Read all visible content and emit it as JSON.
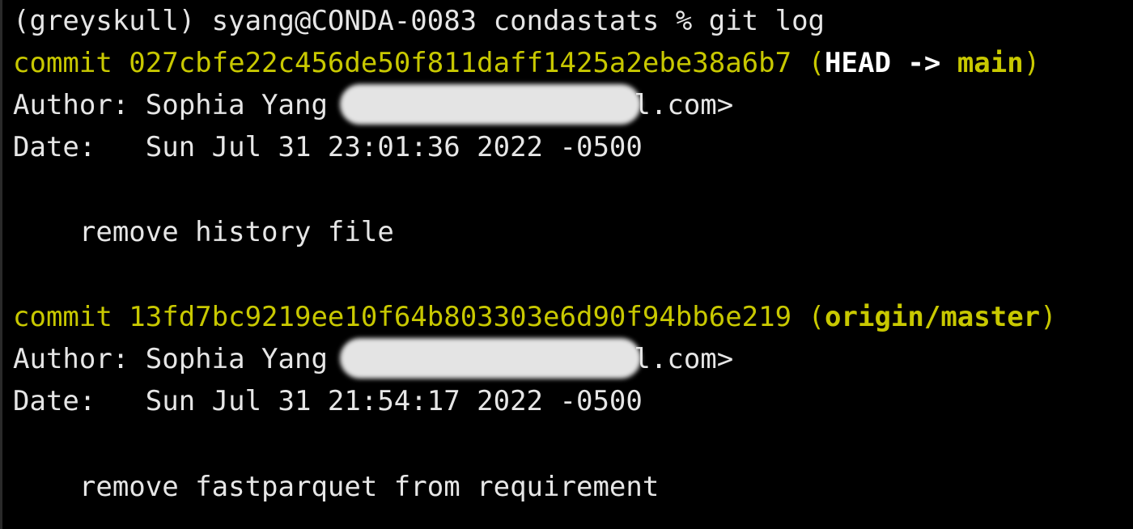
{
  "terminal": {
    "prompt": "(greyskull) syang@CONDA-0083 condastats % git log",
    "commits": [
      {
        "commit_word": "commit ",
        "hash": "027cbfe22c456de50f811daff1425a2ebe38a6b7",
        "ref_open": " (",
        "head_label": "HEAD -> ",
        "branch": "main",
        "ref_close": ")",
        "author_prefix": "Author: Sophia Yang",
        "author_suffix": "il.com>",
        "date_line": "Date:   Sun Jul 31 23:01:36 2022 -0500",
        "message": "    remove history file"
      },
      {
        "commit_word": "commit ",
        "hash": "13fd7bc9219ee10f64b803303e6d90f94bb6e219",
        "ref_open": " (",
        "branch": "origin/master",
        "ref_close": ")",
        "author_prefix": "Author: Sophia Yang",
        "author_suffix": "il.com>",
        "date_line": "Date:   Sun Jul 31 21:54:17 2022 -0500",
        "message": "    remove fastparquet from requirement"
      }
    ]
  },
  "colors": {
    "background": "#000000",
    "text": "#e6e6e6",
    "commit_yellow": "#c8c800",
    "redaction": "#e4e4e4"
  }
}
